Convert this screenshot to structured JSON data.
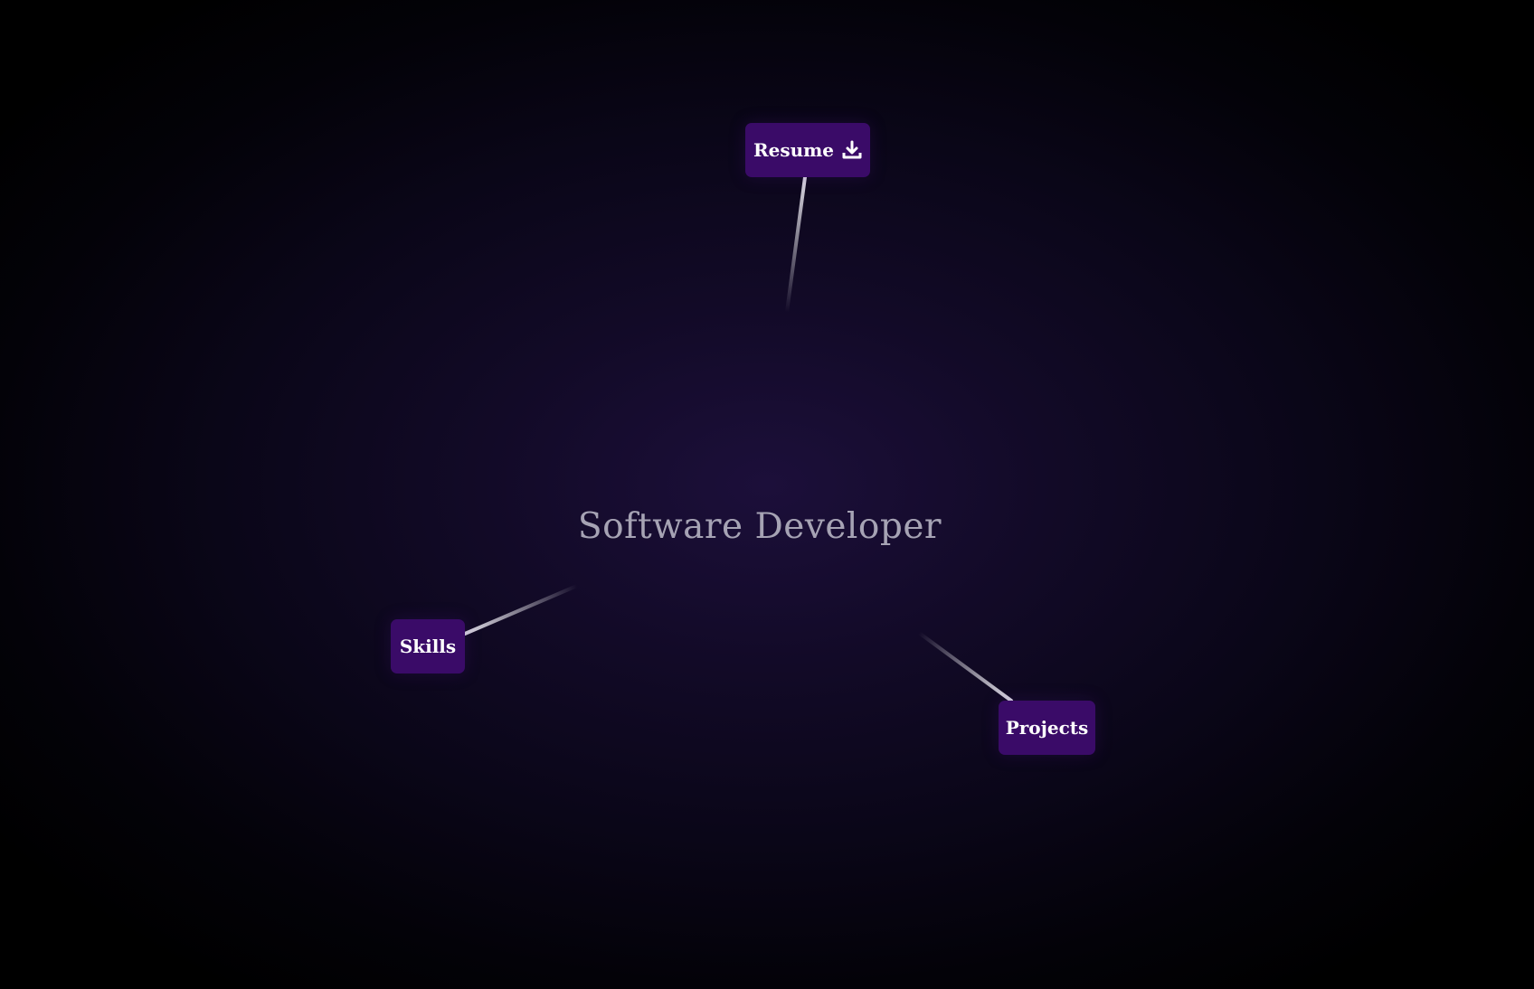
{
  "title": "Software Developer",
  "nodes": {
    "resume": {
      "label": "Resume",
      "icon": "download-icon"
    },
    "skills": {
      "label": "Skills"
    },
    "projects": {
      "label": "Projects"
    }
  },
  "colors": {
    "node_background": "#3a0b68",
    "node_text": "#ffffff",
    "title_text": "#a6a3b4",
    "background_center": "#1c0f3a",
    "background_edge": "#000000"
  }
}
